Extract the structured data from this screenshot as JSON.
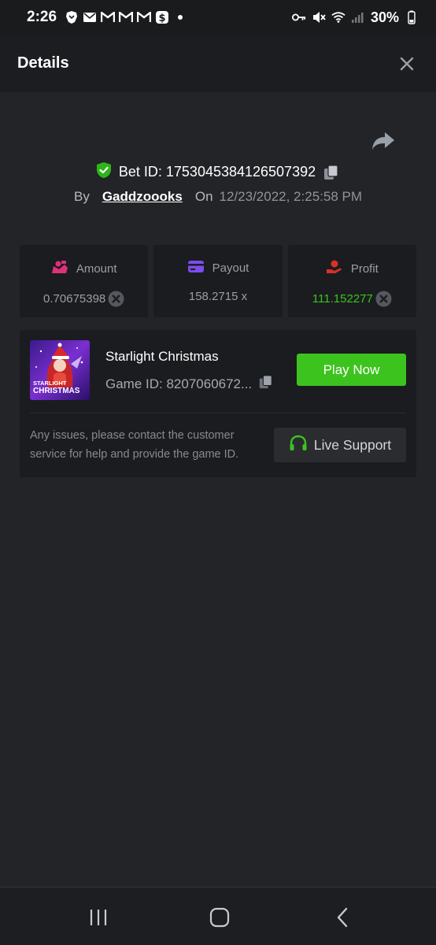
{
  "status_bar": {
    "time": "2:26",
    "battery": "30%",
    "icons_left": [
      "brave-icon",
      "mail-icon",
      "gmail-icon",
      "gmail-icon",
      "gmail-icon",
      "cash-icon",
      "dot-icon"
    ],
    "icons_right": [
      "key-icon",
      "mute-icon",
      "wifi-icon",
      "signal-icon",
      "battery-icon"
    ]
  },
  "header": {
    "title": "Details"
  },
  "bet": {
    "id_text": "Bet ID: 1753045384126507392",
    "by_label": "By",
    "username": "Gaddzoooks",
    "on_label": "On",
    "date": "12/23/2022, 2:25:58 PM"
  },
  "stats": {
    "amount": {
      "label": "Amount",
      "value": "0.70675398"
    },
    "payout": {
      "label": "Payout",
      "value": "158.2715 x"
    },
    "profit": {
      "label": "Profit",
      "value": "111.152277"
    }
  },
  "game": {
    "name": "Starlight Christmas",
    "id_text": "Game ID: 8207060672...",
    "thumb_line1": "STARLIGHT",
    "thumb_line2": "CHRISTMAS",
    "play_label": "Play Now",
    "support_text": "Any issues, please contact the customer service for help and provide the game ID.",
    "support_label": "Live Support"
  },
  "colors": {
    "accent_green": "#3cc31e",
    "profit_green": "#39c51e",
    "amount_icon": "#e0307a",
    "payout_icon": "#7b4cf0",
    "profit_icon": "#d9302a"
  }
}
